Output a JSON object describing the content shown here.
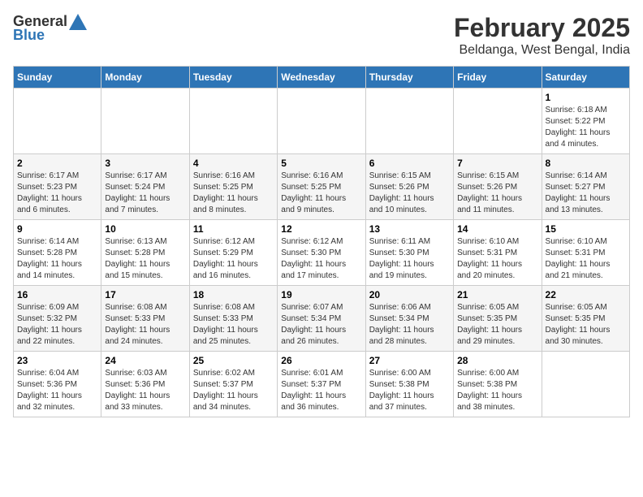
{
  "logo": {
    "general": "General",
    "blue": "Blue"
  },
  "title": "February 2025",
  "subtitle": "Beldanga, West Bengal, India",
  "days_of_week": [
    "Sunday",
    "Monday",
    "Tuesday",
    "Wednesday",
    "Thursday",
    "Friday",
    "Saturday"
  ],
  "weeks": [
    {
      "bg": "white",
      "days": [
        {
          "date": "",
          "info": ""
        },
        {
          "date": "",
          "info": ""
        },
        {
          "date": "",
          "info": ""
        },
        {
          "date": "",
          "info": ""
        },
        {
          "date": "",
          "info": ""
        },
        {
          "date": "",
          "info": ""
        },
        {
          "date": "1",
          "info": "Sunrise: 6:18 AM\nSunset: 5:22 PM\nDaylight: 11 hours\nand 4 minutes."
        }
      ]
    },
    {
      "bg": "gray",
      "days": [
        {
          "date": "2",
          "info": "Sunrise: 6:17 AM\nSunset: 5:23 PM\nDaylight: 11 hours\nand 6 minutes."
        },
        {
          "date": "3",
          "info": "Sunrise: 6:17 AM\nSunset: 5:24 PM\nDaylight: 11 hours\nand 7 minutes."
        },
        {
          "date": "4",
          "info": "Sunrise: 6:16 AM\nSunset: 5:25 PM\nDaylight: 11 hours\nand 8 minutes."
        },
        {
          "date": "5",
          "info": "Sunrise: 6:16 AM\nSunset: 5:25 PM\nDaylight: 11 hours\nand 9 minutes."
        },
        {
          "date": "6",
          "info": "Sunrise: 6:15 AM\nSunset: 5:26 PM\nDaylight: 11 hours\nand 10 minutes."
        },
        {
          "date": "7",
          "info": "Sunrise: 6:15 AM\nSunset: 5:26 PM\nDaylight: 11 hours\nand 11 minutes."
        },
        {
          "date": "8",
          "info": "Sunrise: 6:14 AM\nSunset: 5:27 PM\nDaylight: 11 hours\nand 13 minutes."
        }
      ]
    },
    {
      "bg": "white",
      "days": [
        {
          "date": "9",
          "info": "Sunrise: 6:14 AM\nSunset: 5:28 PM\nDaylight: 11 hours\nand 14 minutes."
        },
        {
          "date": "10",
          "info": "Sunrise: 6:13 AM\nSunset: 5:28 PM\nDaylight: 11 hours\nand 15 minutes."
        },
        {
          "date": "11",
          "info": "Sunrise: 6:12 AM\nSunset: 5:29 PM\nDaylight: 11 hours\nand 16 minutes."
        },
        {
          "date": "12",
          "info": "Sunrise: 6:12 AM\nSunset: 5:30 PM\nDaylight: 11 hours\nand 17 minutes."
        },
        {
          "date": "13",
          "info": "Sunrise: 6:11 AM\nSunset: 5:30 PM\nDaylight: 11 hours\nand 19 minutes."
        },
        {
          "date": "14",
          "info": "Sunrise: 6:10 AM\nSunset: 5:31 PM\nDaylight: 11 hours\nand 20 minutes."
        },
        {
          "date": "15",
          "info": "Sunrise: 6:10 AM\nSunset: 5:31 PM\nDaylight: 11 hours\nand 21 minutes."
        }
      ]
    },
    {
      "bg": "gray",
      "days": [
        {
          "date": "16",
          "info": "Sunrise: 6:09 AM\nSunset: 5:32 PM\nDaylight: 11 hours\nand 22 minutes."
        },
        {
          "date": "17",
          "info": "Sunrise: 6:08 AM\nSunset: 5:33 PM\nDaylight: 11 hours\nand 24 minutes."
        },
        {
          "date": "18",
          "info": "Sunrise: 6:08 AM\nSunset: 5:33 PM\nDaylight: 11 hours\nand 25 minutes."
        },
        {
          "date": "19",
          "info": "Sunrise: 6:07 AM\nSunset: 5:34 PM\nDaylight: 11 hours\nand 26 minutes."
        },
        {
          "date": "20",
          "info": "Sunrise: 6:06 AM\nSunset: 5:34 PM\nDaylight: 11 hours\nand 28 minutes."
        },
        {
          "date": "21",
          "info": "Sunrise: 6:05 AM\nSunset: 5:35 PM\nDaylight: 11 hours\nand 29 minutes."
        },
        {
          "date": "22",
          "info": "Sunrise: 6:05 AM\nSunset: 5:35 PM\nDaylight: 11 hours\nand 30 minutes."
        }
      ]
    },
    {
      "bg": "white",
      "days": [
        {
          "date": "23",
          "info": "Sunrise: 6:04 AM\nSunset: 5:36 PM\nDaylight: 11 hours\nand 32 minutes."
        },
        {
          "date": "24",
          "info": "Sunrise: 6:03 AM\nSunset: 5:36 PM\nDaylight: 11 hours\nand 33 minutes."
        },
        {
          "date": "25",
          "info": "Sunrise: 6:02 AM\nSunset: 5:37 PM\nDaylight: 11 hours\nand 34 minutes."
        },
        {
          "date": "26",
          "info": "Sunrise: 6:01 AM\nSunset: 5:37 PM\nDaylight: 11 hours\nand 36 minutes."
        },
        {
          "date": "27",
          "info": "Sunrise: 6:00 AM\nSunset: 5:38 PM\nDaylight: 11 hours\nand 37 minutes."
        },
        {
          "date": "28",
          "info": "Sunrise: 6:00 AM\nSunset: 5:38 PM\nDaylight: 11 hours\nand 38 minutes."
        },
        {
          "date": "",
          "info": ""
        }
      ]
    }
  ]
}
